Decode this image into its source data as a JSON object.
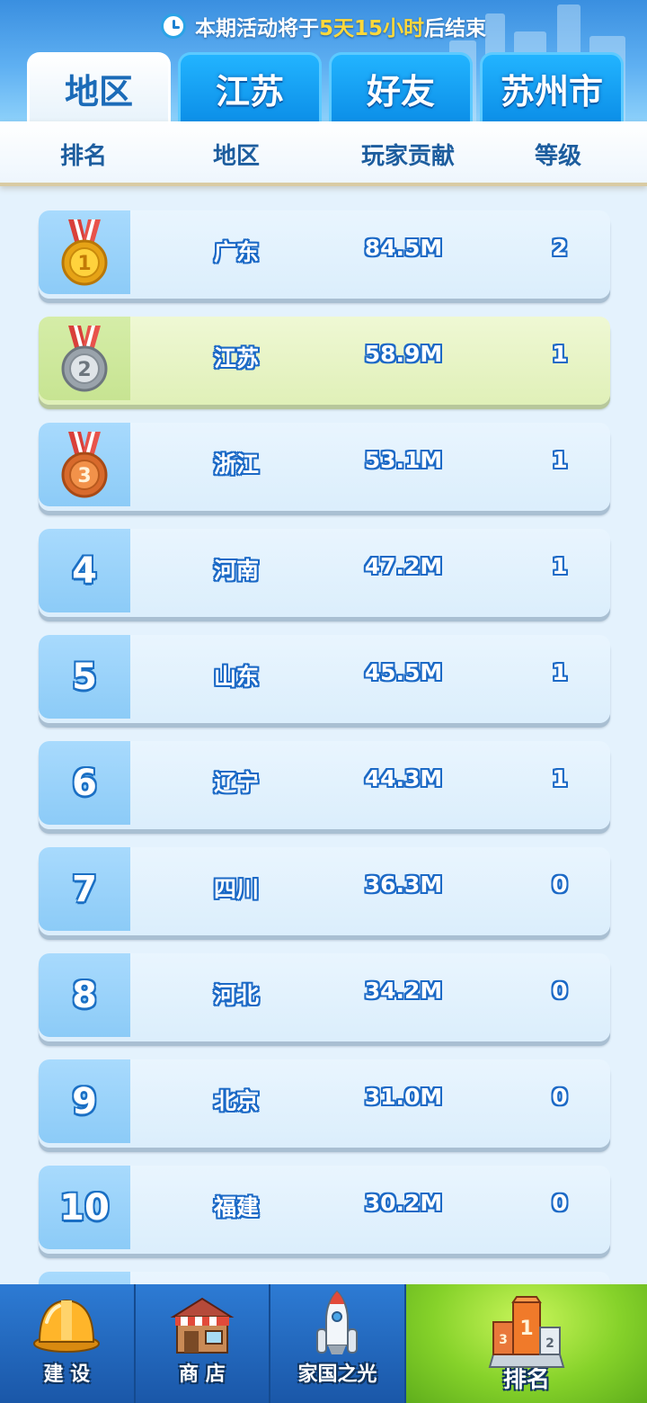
{
  "timer": {
    "prefix": "本期活动将于",
    "highlight": "5天15小时",
    "suffix": "后结束"
  },
  "tabs": [
    {
      "label": "地区",
      "active": true
    },
    {
      "label": "江苏",
      "active": false
    },
    {
      "label": "好友",
      "active": false
    },
    {
      "label": "苏州市",
      "active": false
    }
  ],
  "columns": {
    "rank": "排名",
    "region": "地区",
    "contribution": "玩家贡献",
    "level": "等级"
  },
  "rows": [
    {
      "rank": "1",
      "region": "广东",
      "contribution": "84.5M",
      "level": "2",
      "medal": "gold"
    },
    {
      "rank": "2",
      "region": "江苏",
      "contribution": "58.9M",
      "level": "1",
      "medal": "silver",
      "highlighted": true
    },
    {
      "rank": "3",
      "region": "浙江",
      "contribution": "53.1M",
      "level": "1",
      "medal": "bronze"
    },
    {
      "rank": "4",
      "region": "河南",
      "contribution": "47.2M",
      "level": "1"
    },
    {
      "rank": "5",
      "region": "山东",
      "contribution": "45.5M",
      "level": "1"
    },
    {
      "rank": "6",
      "region": "辽宁",
      "contribution": "44.3M",
      "level": "1"
    },
    {
      "rank": "7",
      "region": "四川",
      "contribution": "36.3M",
      "level": "0"
    },
    {
      "rank": "8",
      "region": "河北",
      "contribution": "34.2M",
      "level": "0"
    },
    {
      "rank": "9",
      "region": "北京",
      "contribution": "31.0M",
      "level": "0"
    },
    {
      "rank": "10",
      "region": "福建",
      "contribution": "30.2M",
      "level": "0"
    }
  ],
  "nav": [
    {
      "label": "建 设",
      "icon": "hard-hat-icon"
    },
    {
      "label": "商 店",
      "icon": "shop-icon"
    },
    {
      "label": "家国之光",
      "icon": "rocket-icon"
    },
    {
      "label": "排名",
      "icon": "podium-icon",
      "active": true
    }
  ],
  "colors": {
    "accent_blue": "#1b69c6",
    "timer_highlight": "#ffd83a",
    "active_nav": "#86d22a",
    "highlight_row": "#e0f0b8"
  }
}
